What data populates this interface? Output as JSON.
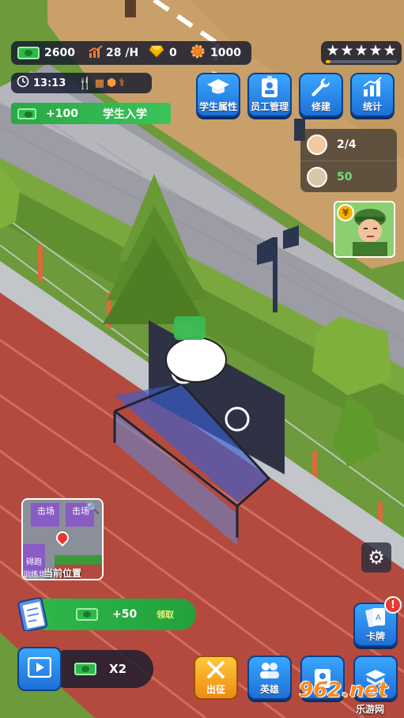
{
  "resources": {
    "cash": "2600",
    "rate": "28 /H",
    "gems": "0",
    "gears": "1000"
  },
  "time": "13:13",
  "income_banner": {
    "amount": "+100",
    "text": "学生入学"
  },
  "top_buttons": [
    {
      "label": "学生属性",
      "icon": "graduation-cap-icon"
    },
    {
      "label": "员工管理",
      "icon": "id-badge-icon"
    },
    {
      "label": "修建",
      "icon": "wrench-icon"
    },
    {
      "label": "统计",
      "icon": "bar-chart-icon"
    }
  ],
  "rating_stars": 5,
  "people": {
    "students": "2/4",
    "staff": "50"
  },
  "minimap": {
    "labels": [
      "击场",
      "击场",
      "碍跑",
      "训练场"
    ],
    "current_location": "当前位置"
  },
  "reward_bar": {
    "amount": "+50",
    "claim": "领取"
  },
  "speed": {
    "multiplier": "X2"
  },
  "bottom_buttons": [
    {
      "label": "出征",
      "icon": "crossed-swords-icon"
    },
    {
      "label": "英雄",
      "icon": "heroes-icon"
    },
    {
      "label": "卡牌",
      "icon": "cards-icon"
    }
  ],
  "watermark": "962.net",
  "watermark_sub": "乐游网",
  "colors": {
    "accent_green": "#2fb84a",
    "button_blue": "#2a86ea",
    "gold": "#f5b400",
    "alert_red": "#e8392f"
  }
}
